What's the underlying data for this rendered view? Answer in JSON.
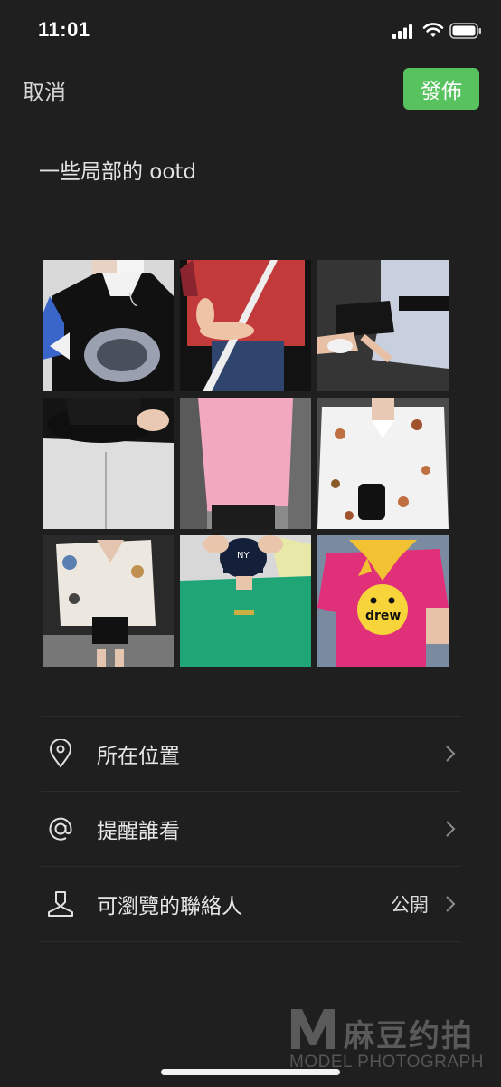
{
  "status_bar": {
    "time": "11:01"
  },
  "header": {
    "cancel_label": "取消",
    "publish_label": "發佈"
  },
  "post": {
    "text": "一些局部的 ootd"
  },
  "photos": [
    {
      "id": "photo-1"
    },
    {
      "id": "photo-2"
    },
    {
      "id": "photo-3"
    },
    {
      "id": "photo-4"
    },
    {
      "id": "photo-5"
    },
    {
      "id": "photo-6"
    },
    {
      "id": "photo-7"
    },
    {
      "id": "photo-8"
    },
    {
      "id": "photo-9"
    }
  ],
  "photo_texts": {
    "drew": "drew",
    "ny": "NY"
  },
  "options": [
    {
      "label": "所在位置",
      "icon": "location-pin-icon",
      "value": ""
    },
    {
      "label": "提醒誰看",
      "icon": "at-sign-icon",
      "value": ""
    },
    {
      "label": "可瀏覽的聯絡人",
      "icon": "person-icon",
      "value": "公開"
    }
  ],
  "watermark": {
    "chinese": "麻豆约拍",
    "english": "MODEL PHOTOGRAPH"
  },
  "colors": {
    "background": "#1f1f1f",
    "publish_green": "#58c25f"
  }
}
